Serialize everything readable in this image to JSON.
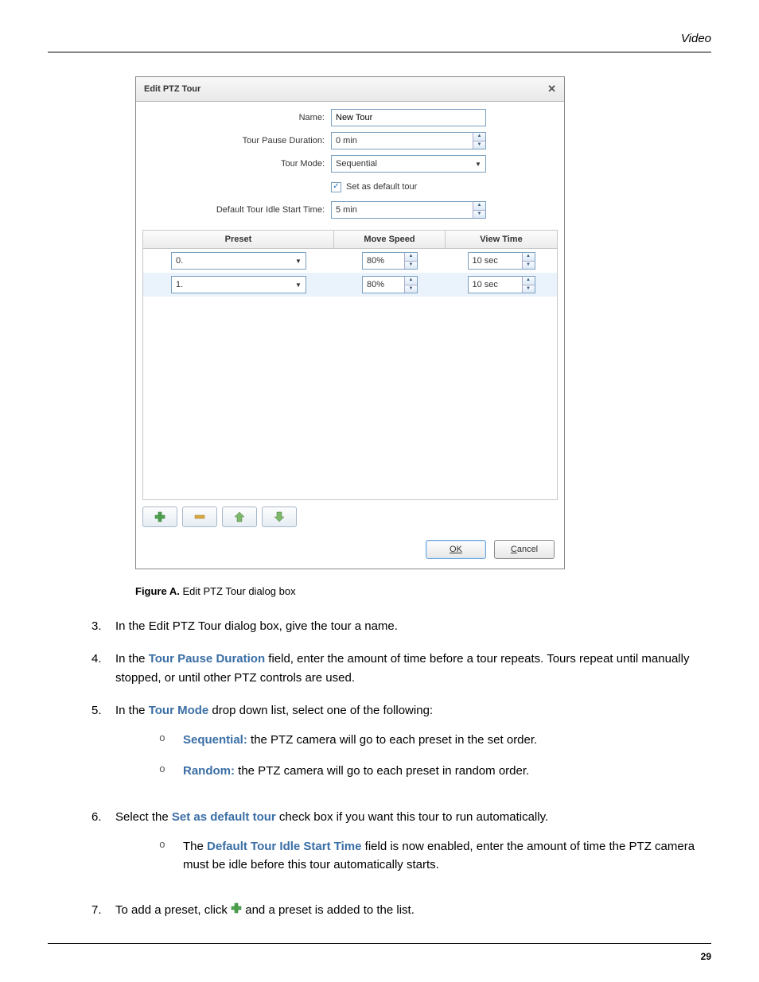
{
  "header": {
    "section": "Video"
  },
  "dialog": {
    "title": "Edit PTZ Tour",
    "labels": {
      "name": "Name:",
      "pause": "Tour Pause Duration:",
      "mode": "Tour Mode:",
      "default_chk": "Set as default tour",
      "idle": "Default Tour Idle Start Time:"
    },
    "values": {
      "name": "New Tour",
      "pause": "0 min",
      "mode": "Sequential",
      "default_checked": true,
      "idle": "5 min"
    },
    "table": {
      "headers": {
        "preset": "Preset",
        "speed": "Move Speed",
        "view": "View Time"
      },
      "rows": [
        {
          "preset": "0.",
          "speed": "80%",
          "view": "10 sec"
        },
        {
          "preset": "1.",
          "speed": "80%",
          "view": "10 sec"
        }
      ]
    },
    "toolbar_icons": [
      "add",
      "remove",
      "up",
      "down"
    ],
    "buttons": {
      "ok": "OK",
      "cancel": "Cancel"
    }
  },
  "caption": {
    "label": "Figure A.",
    "text": "Edit PTZ Tour dialog box"
  },
  "steps": {
    "s3": "In the Edit PTZ Tour dialog box, give the tour a name.",
    "s4_a": "In the ",
    "s4_b": "Tour Pause Duration",
    "s4_c": " field, enter the amount of time before a tour repeats. Tours repeat until manually stopped, or until other PTZ controls are used.",
    "s5_a": "In the ",
    "s5_b": "Tour Mode",
    "s5_c": " drop down list, select one of the following:",
    "s5_seq_a": "Sequential:",
    "s5_seq_b": " the PTZ camera will go to each preset in the set order.",
    "s5_rnd_a": "Random:",
    "s5_rnd_b": " the PTZ camera will go to each preset in random order.",
    "s6_a": "Select the ",
    "s6_b": "Set as default tour",
    "s6_c": " check box if you want this tour to run automatically.",
    "s6_sub_a": "The ",
    "s6_sub_b": "Default Tour Idle Start Time",
    "s6_sub_c": " field is now enabled, enter the amount of time the PTZ camera must be idle before this tour automatically starts.",
    "s7_a": "To add a preset, click ",
    "s7_b": " and a preset is added to the list."
  },
  "page_number": "29"
}
